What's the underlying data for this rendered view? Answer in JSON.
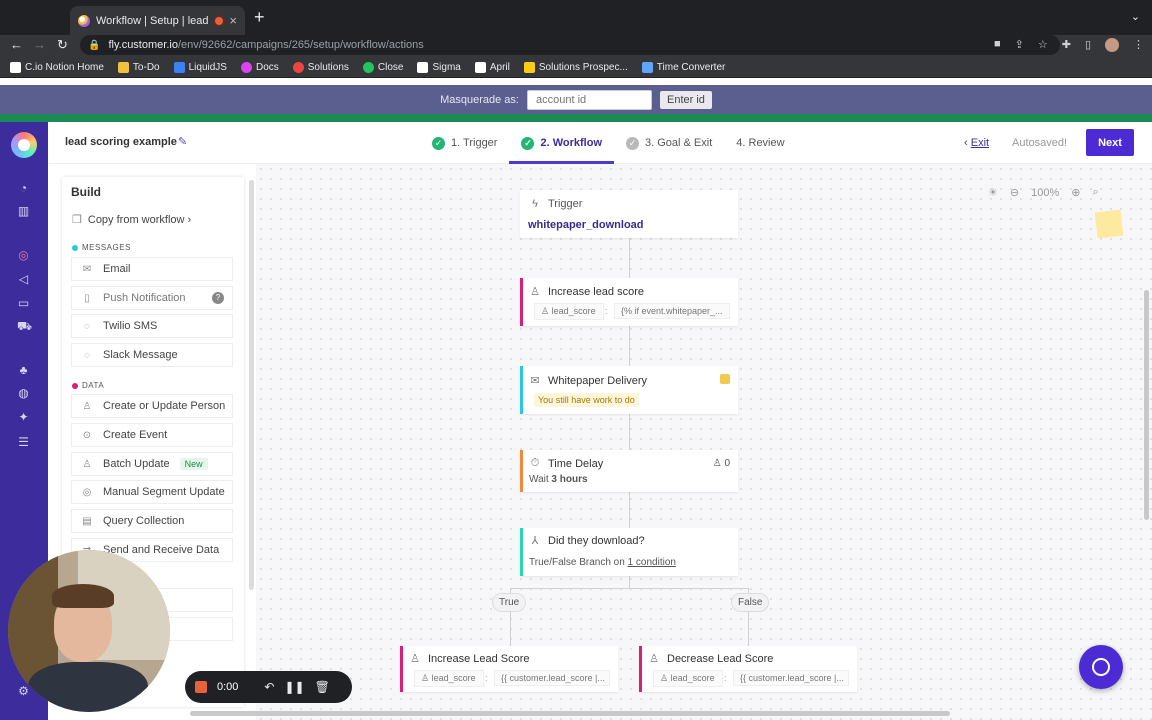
{
  "browser": {
    "tab_title": "Workflow | Setup | lead sco",
    "tab_close": "×",
    "new_tab": "+",
    "url_host": "fly.customer.io",
    "url_path": "/env/92662/campaigns/265/setup/workflow/actions",
    "bookmarks": [
      {
        "label": "C.io Notion Home",
        "color": "#ffffff"
      },
      {
        "label": "To-Do",
        "color": "#f0c040"
      },
      {
        "label": "LiquidJS",
        "color": "#3b82f6"
      },
      {
        "label": "Docs",
        "color": "#d946ef"
      },
      {
        "label": "Solutions",
        "color": "#ef4444"
      },
      {
        "label": "Close",
        "color": "#22c55e"
      },
      {
        "label": "Sigma",
        "color": "#ffffff"
      },
      {
        "label": "April",
        "color": "#ffffff"
      },
      {
        "label": "Solutions Prospec...",
        "color": "#facc15"
      },
      {
        "label": "Time Converter",
        "color": "#60a5fa"
      }
    ]
  },
  "masquerade": {
    "label": "Masquerade as:",
    "placeholder": "account id",
    "button": "Enter id"
  },
  "header": {
    "campaign_name": "lead scoring example",
    "steps": [
      {
        "label": "1. Trigger",
        "state": "done"
      },
      {
        "label": "2. Workflow",
        "state": "active"
      },
      {
        "label": "3. Goal & Exit",
        "state": "pending"
      },
      {
        "label": "4. Review",
        "state": "none"
      }
    ],
    "exit": "Exit",
    "autosaved": "Autosaved!",
    "next": "Next"
  },
  "build": {
    "title": "Build",
    "copy": "Copy from workflow ›",
    "messages_label": "MESSAGES",
    "messages": [
      {
        "label": "Email",
        "icon": "mail-icon"
      },
      {
        "label": "Push Notification",
        "icon": "phone-icon"
      },
      {
        "label": "Twilio SMS",
        "icon": "sms-icon"
      },
      {
        "label": "Slack Message",
        "icon": "chat-icon"
      }
    ],
    "data_label": "DATA",
    "data": [
      {
        "label": "Create or Update Person",
        "icon": "person-icon"
      },
      {
        "label": "Create Event",
        "icon": "event-icon"
      },
      {
        "label": "Batch Update",
        "icon": "batch-icon",
        "badge": "New"
      },
      {
        "label": "Manual Segment Update",
        "icon": "segment-icon"
      },
      {
        "label": "Query Collection",
        "icon": "collection-icon"
      },
      {
        "label": "Send and Receive Data",
        "icon": "webhook-icon"
      }
    ],
    "colors": {
      "messages": "#2bc6e0",
      "data": "#d6207a"
    }
  },
  "canvas": {
    "zoom": "100%",
    "trigger": {
      "label": "Trigger",
      "event": "whitepaper_download"
    },
    "increase1": {
      "title": "Increase lead score",
      "attr": "lead_score",
      "sep": ":",
      "value": "{% if event.whitepaper_..."
    },
    "delivery": {
      "title": "Whitepaper Delivery",
      "warning": "You still have work to do"
    },
    "delay": {
      "title": "Time Delay",
      "count": "0",
      "prefix": "Wait",
      "amount": "3 hours"
    },
    "branch": {
      "title": "Did they download?",
      "prefix": "True/False Branch on",
      "link": "1 condition"
    },
    "true_label": "True",
    "false_label": "False",
    "increase2": {
      "title": "Increase Lead Score",
      "attr": "lead_score",
      "sep": ":",
      "value": "{{ customer.lead_score |..."
    },
    "decrease": {
      "title": "Decrease Lead Score",
      "attr": "lead_score",
      "sep": ":",
      "value": "{{ customer.lead_score |..."
    }
  },
  "recorder": {
    "time": "0:00"
  }
}
